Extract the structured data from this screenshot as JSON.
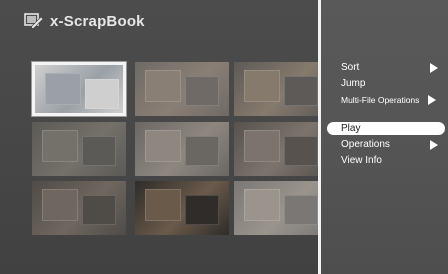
{
  "app": {
    "title": "x-ScrapBook",
    "icon": "scrapbook-pencil-icon"
  },
  "thumbnails": [
    {
      "name": "scrapbook-page-1",
      "selected": true,
      "bg": "#cfcfcf",
      "accent": "#9aa0a6"
    },
    {
      "name": "scrapbook-page-2",
      "selected": false,
      "bg": "#6f6a66",
      "accent": "#8a7f75"
    },
    {
      "name": "scrapbook-page-3",
      "selected": false,
      "bg": "#5e5a57",
      "accent": "#867a6d"
    },
    {
      "name": "scrapbook-page-4",
      "selected": false,
      "bg": "#5c5a56",
      "accent": "#74706a"
    },
    {
      "name": "scrapbook-page-5",
      "selected": false,
      "bg": "#6a6763",
      "accent": "#8e8780"
    },
    {
      "name": "scrapbook-page-6",
      "selected": false,
      "bg": "#57524e",
      "accent": "#7c746c"
    },
    {
      "name": "scrapbook-page-7",
      "selected": false,
      "bg": "#4f4b47",
      "accent": "#6f675f"
    },
    {
      "name": "scrapbook-page-8",
      "selected": false,
      "bg": "#2f2c2a",
      "accent": "#6a5a4a"
    },
    {
      "name": "scrapbook-page-9",
      "selected": false,
      "bg": "#7a7775",
      "accent": "#9a948d"
    }
  ],
  "menu": {
    "items": [
      {
        "label": "Sort",
        "submenu": true,
        "highlighted": false,
        "small": false
      },
      {
        "label": "Jump",
        "submenu": false,
        "highlighted": false,
        "small": false
      },
      {
        "label": "Multi-File Operations",
        "submenu": true,
        "highlighted": false,
        "small": true
      },
      {
        "label": "Play",
        "submenu": false,
        "highlighted": true,
        "small": false
      },
      {
        "label": "Operations",
        "submenu": true,
        "highlighted": false,
        "small": false
      },
      {
        "label": "View Info",
        "submenu": false,
        "highlighted": false,
        "small": false
      }
    ]
  },
  "colors": {
    "divider": "#f2f2f2",
    "menu_text": "#ffffff",
    "highlight": "#ffffff"
  }
}
